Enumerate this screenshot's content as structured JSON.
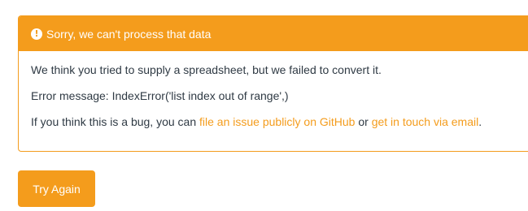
{
  "alert": {
    "title": "Sorry, we can't process that data",
    "icon": "exclamation-circle-icon",
    "line1": "We think you tried to supply a spreadsheet, but we failed to convert it.",
    "error_prefix": "Error message: ",
    "error_message": "IndexError('list index out of range',)",
    "bug_prefix": "If you think this is a bug, you can ",
    "github_link": "file an issue publicly on GitHub",
    "connector": " or ",
    "email_link": "get in touch via email",
    "suffix": "."
  },
  "actions": {
    "try_again_label": "Try Again"
  },
  "colors": {
    "accent": "#f49c1c",
    "text": "#2f3a44"
  }
}
